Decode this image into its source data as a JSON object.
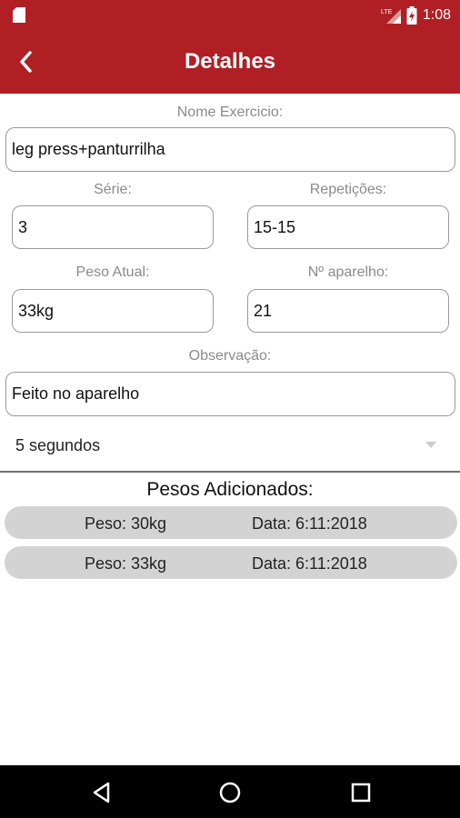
{
  "status_bar": {
    "time": "1:08",
    "network": "LTE",
    "icons": [
      "sd-card-icon",
      "signal-icon",
      "battery-charging-icon"
    ]
  },
  "app_bar": {
    "title": "Detalhes",
    "back_icon": "back-chevron-icon"
  },
  "form": {
    "nome_label": "Nome Exercicio:",
    "nome_value": "leg press+panturrilha",
    "serie_label": "Série:",
    "serie_value": "3",
    "repeticoes_label": "Repetições:",
    "repeticoes_value": "15-15",
    "peso_label": "Peso Atual:",
    "peso_value": "33kg",
    "aparelho_label": "Nº aparelho:",
    "aparelho_value": "21",
    "observacao_label": "Observação:",
    "observacao_value": "Feito no aparelho",
    "descanso_selected": "5 segundos"
  },
  "weights": {
    "title": "Pesos Adicionados:",
    "items": [
      {
        "peso": "Peso: 30kg",
        "data": "Data: 6:11:2018"
      },
      {
        "peso": "Peso: 33kg",
        "data": "Data: 6:11:2018"
      }
    ]
  },
  "colors": {
    "primary": "#b01f24",
    "row_background": "#d3d3d3",
    "label_gray": "#8a8a8a"
  },
  "nav_bar": {
    "icons": [
      "nav-back-icon",
      "nav-home-icon",
      "nav-recents-icon"
    ]
  }
}
